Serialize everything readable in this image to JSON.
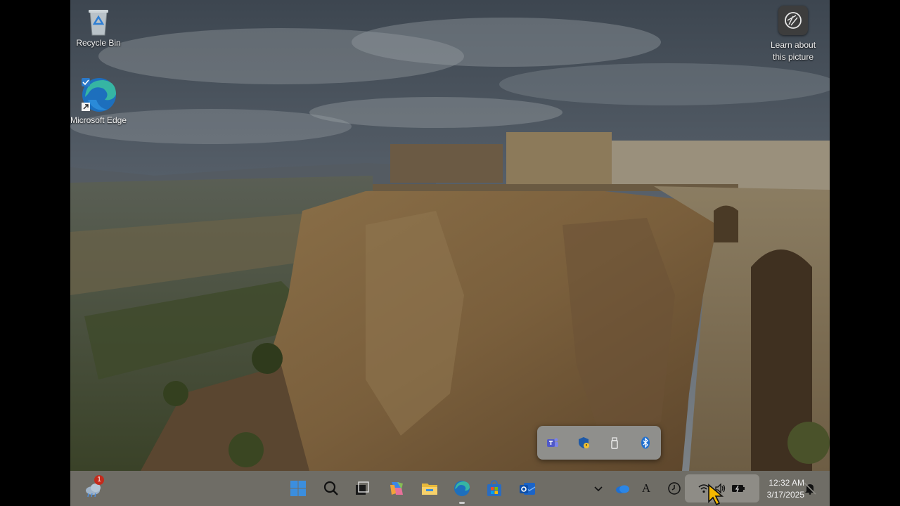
{
  "desktop": {
    "icons": [
      {
        "label": "Recycle Bin",
        "icon": "recycle-bin-icon"
      },
      {
        "label": "Microsoft Edge",
        "icon": "edge-icon"
      }
    ],
    "spotlight": {
      "label": "Learn about this picture",
      "icon": "camera-lens-icon"
    }
  },
  "tray_overflow": {
    "items": [
      "teams-icon",
      "windows-security-icon",
      "usb-drive-icon",
      "bluetooth-icon"
    ]
  },
  "taskbar": {
    "widgets": {
      "icon": "weather-widget-icon",
      "badge": "1"
    },
    "apps": [
      "start-icon",
      "search-icon",
      "task-view-icon",
      "copilot-icon",
      "file-explorer-icon",
      "edge-icon",
      "microsoft-store-icon",
      "outlook-icon"
    ],
    "tray": {
      "chevron": "chevron-up-icon",
      "onedrive": "onedrive-icon",
      "ime": "A",
      "clock_app": "clock-icon",
      "wifi": "wifi-icon",
      "volume": "volume-icon",
      "battery": "battery-charging-icon"
    },
    "time": "12:32 AM",
    "date": "3/17/2025",
    "notifications": "notification-bell-icon"
  },
  "colors": {
    "taskbar_bg": "#6f6d66",
    "accent": "#3b8ede"
  }
}
